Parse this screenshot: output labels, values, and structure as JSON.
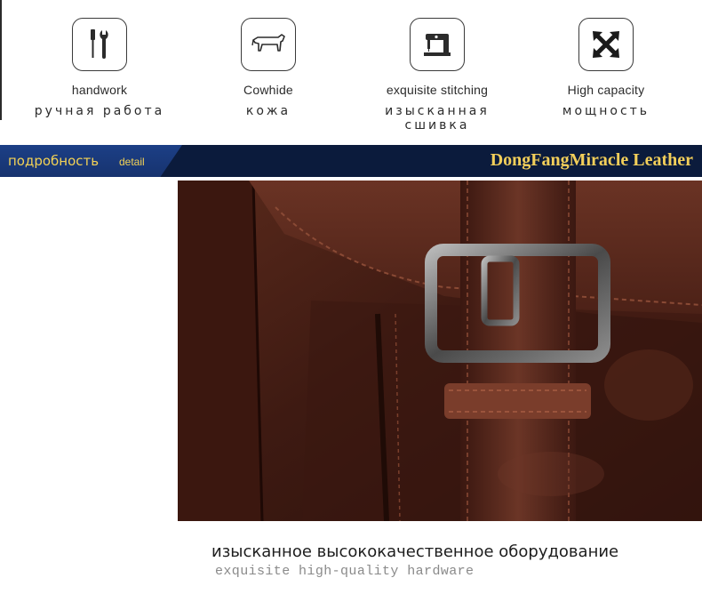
{
  "features": [
    {
      "icon": "tools-icon",
      "label_en": "handwork",
      "label_ru": "ручная работа"
    },
    {
      "icon": "cow-icon",
      "label_en": "Cowhide",
      "label_ru": "кожа"
    },
    {
      "icon": "sewing-machine-icon",
      "label_en": "exquisite stitching",
      "label_ru": "изысканная сшивка"
    },
    {
      "icon": "expand-arrows-icon",
      "label_en": "High capacity",
      "label_ru": "мощность"
    }
  ],
  "header": {
    "title_ru": "подробность",
    "title_en": "detail",
    "brand": "DongFangMiracle Leather",
    "accent_color": "#f3d255",
    "bar_color": "#0b1b3c"
  },
  "caption": {
    "ru": "изысканное высококачественное оборудование",
    "en": "exquisite high-quality hardware"
  }
}
